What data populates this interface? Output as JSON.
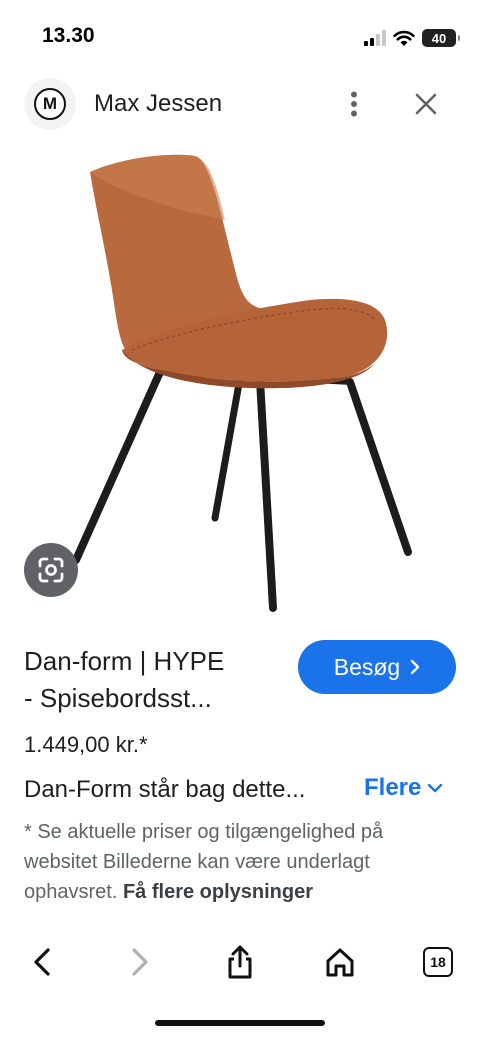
{
  "status": {
    "time": "13.30",
    "battery": "40"
  },
  "header": {
    "site_initial": "M",
    "site_name": "Max Jessen",
    "more_icon": "more-vertical-icon",
    "close_icon": "close-icon"
  },
  "product": {
    "title_line1": "Dan-form | HYPE",
    "title_line2": "- Spisebordsst...",
    "visit_label": "Besøg",
    "price": "1.449,00 kr.*",
    "description": "Dan-Form står bag dette...",
    "more_label": "Flere",
    "disclaimer": "* Se aktuelle priser og tilgængelighed på websitet Billederne kan være underlagt ophavsret.",
    "disclaimer_link": "Få flere oplysninger"
  },
  "toolbar": {
    "tabs_count": "18"
  },
  "colors": {
    "accent": "#1a73e8",
    "leather": "#b8693e",
    "legs": "#1c1c1c"
  }
}
